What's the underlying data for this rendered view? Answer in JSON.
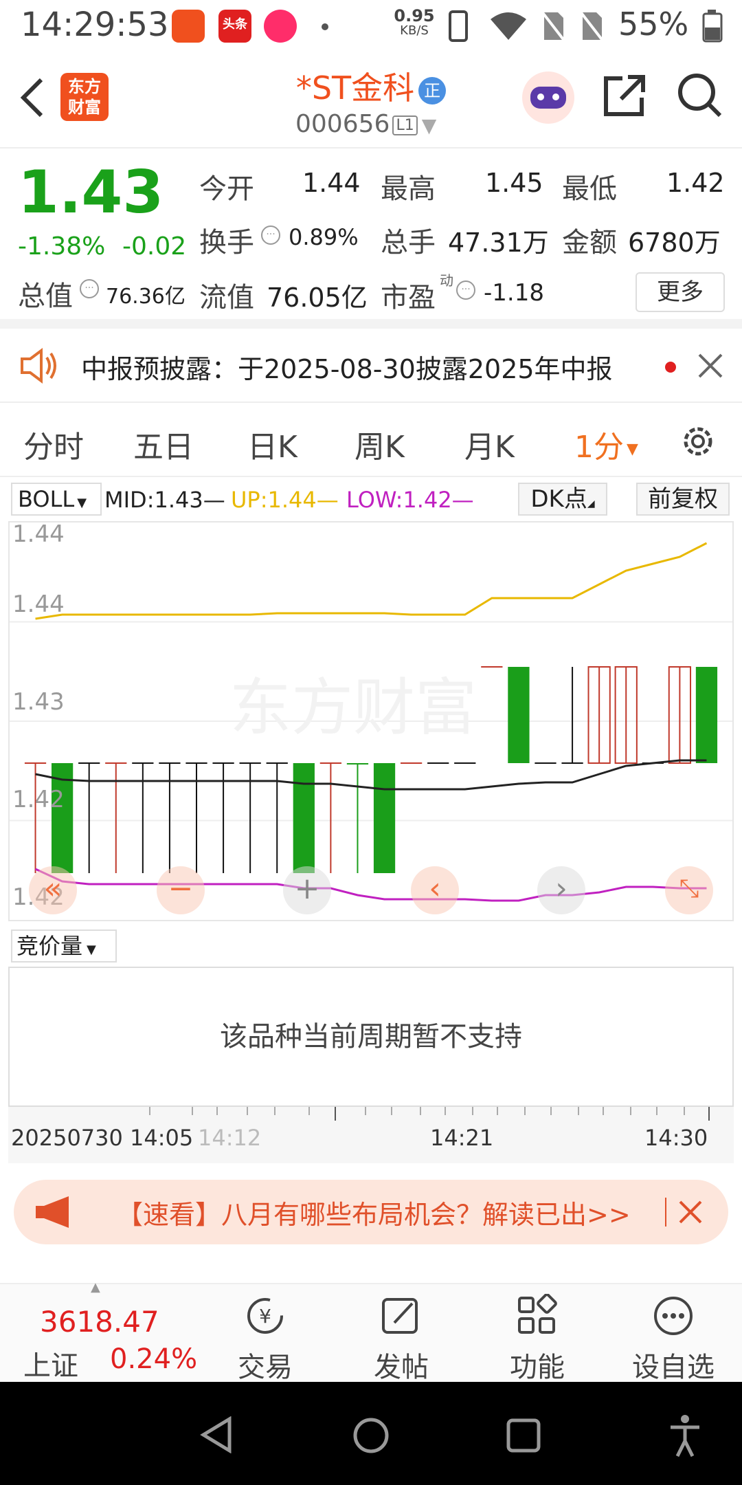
{
  "status_bar": {
    "time": "14:29:53",
    "net_speed": "0.95",
    "net_unit": "KB/S",
    "battery": "55%",
    "app_icons": [
      "toutiao-style-app-icon",
      "toutiao-icon",
      "music-icon"
    ],
    "toutiao_label": "头条"
  },
  "header": {
    "back_icon": "chevron-left-icon",
    "logo_text": "东方财富",
    "title": "*ST金科",
    "badge": "正",
    "code": "000656",
    "level": "L1"
  },
  "quote": {
    "price": "1.43",
    "change_pct": "-1.38%",
    "change": "-0.02",
    "open_label": "今开",
    "open": "1.44",
    "high_label": "最高",
    "high": "1.45",
    "low_label": "最低",
    "low": "1.42",
    "turnover_label": "换手",
    "turnover": "0.89%",
    "volume_label": "总手",
    "volume": "47.31万",
    "amount_label": "金额",
    "amount": "6780万",
    "mktcap_label": "总值",
    "mktcap": "76.36亿",
    "float_label": "流值",
    "float": "76.05亿",
    "pe_label": "市盈",
    "pe_sup": "动",
    "pe": "-1.18",
    "more_label": "更多"
  },
  "notice": {
    "text": "中报预披露：于2025-08-30披露2025年中报"
  },
  "tabs": [
    "分时",
    "五日",
    "日K",
    "周K",
    "月K",
    "1分"
  ],
  "indicator": {
    "name": "BOLL",
    "mid": "MID:1.43—",
    "up": "UP:1.44—",
    "low": "LOW:1.42—",
    "dk_label": "DK点",
    "adjust_label": "前复权"
  },
  "chart_data": {
    "type": "candlestick",
    "y_tick_labels": [
      "1.44",
      "1.44",
      "1.43",
      "1.42",
      "1.42"
    ],
    "x_tick_labels": [
      "20250730 14:05",
      "14:12",
      "14:21",
      "14:30"
    ],
    "watermark": "东方财富",
    "candles": [
      {
        "o": 1.43,
        "c": 1.43,
        "h": 1.43,
        "l": 1.422,
        "color": "red"
      },
      {
        "o": 1.43,
        "c": 1.422,
        "h": 1.43,
        "l": 1.422,
        "color": "green"
      },
      {
        "o": 1.43,
        "c": 1.43,
        "h": 1.43,
        "l": 1.422,
        "color": "black"
      },
      {
        "o": 1.43,
        "c": 1.43,
        "h": 1.43,
        "l": 1.422,
        "color": "red"
      },
      {
        "o": 1.43,
        "c": 1.43,
        "h": 1.43,
        "l": 1.422,
        "color": "black"
      },
      {
        "o": 1.43,
        "c": 1.43,
        "h": 1.43,
        "l": 1.422,
        "color": "black"
      },
      {
        "o": 1.43,
        "c": 1.43,
        "h": 1.43,
        "l": 1.422,
        "color": "black"
      },
      {
        "o": 1.43,
        "c": 1.43,
        "h": 1.43,
        "l": 1.422,
        "color": "black"
      },
      {
        "o": 1.43,
        "c": 1.43,
        "h": 1.43,
        "l": 1.422,
        "color": "black"
      },
      {
        "o": 1.43,
        "c": 1.43,
        "h": 1.43,
        "l": 1.422,
        "color": "black"
      },
      {
        "o": 1.43,
        "c": 1.422,
        "h": 1.43,
        "l": 1.422,
        "color": "green"
      },
      {
        "o": 1.43,
        "c": 1.43,
        "h": 1.43,
        "l": 1.422,
        "color": "red"
      },
      {
        "o": 1.43,
        "c": 1.43,
        "h": 1.43,
        "l": 1.422,
        "color": "green"
      },
      {
        "o": 1.43,
        "c": 1.422,
        "h": 1.43,
        "l": 1.422,
        "color": "green"
      },
      {
        "o": 1.43,
        "c": 1.43,
        "h": 1.43,
        "l": 1.43,
        "color": "red"
      },
      {
        "o": 1.43,
        "c": 1.43,
        "h": 1.43,
        "l": 1.43,
        "color": "black"
      },
      {
        "o": 1.43,
        "c": 1.43,
        "h": 1.43,
        "l": 1.43,
        "color": "black"
      },
      {
        "o": 1.437,
        "c": 1.437,
        "h": 1.437,
        "l": 1.437,
        "color": "red"
      },
      {
        "o": 1.437,
        "c": 1.43,
        "h": 1.437,
        "l": 1.43,
        "color": "green"
      },
      {
        "o": 1.43,
        "c": 1.43,
        "h": 1.43,
        "l": 1.43,
        "color": "black"
      },
      {
        "o": 1.43,
        "c": 1.43,
        "h": 1.437,
        "l": 1.43,
        "color": "black"
      },
      {
        "o": 1.43,
        "c": 1.437,
        "h": 1.437,
        "l": 1.43,
        "color": "red"
      },
      {
        "o": 1.43,
        "c": 1.437,
        "h": 1.437,
        "l": 1.43,
        "color": "red"
      },
      {
        "o": 1.43,
        "c": 1.43,
        "h": 1.43,
        "l": 1.43,
        "color": "black"
      },
      {
        "o": 1.43,
        "c": 1.437,
        "h": 1.437,
        "l": 1.43,
        "color": "red"
      },
      {
        "o": 1.437,
        "c": 1.43,
        "h": 1.437,
        "l": 1.43,
        "color": "green"
      }
    ],
    "boll_up": [
      1.4405,
      1.4408,
      1.4408,
      1.4408,
      1.4408,
      1.4408,
      1.4408,
      1.4408,
      1.4408,
      1.4409,
      1.4409,
      1.4409,
      1.4409,
      1.4409,
      1.4408,
      1.4408,
      1.4408,
      1.442,
      1.442,
      1.442,
      1.442,
      1.443,
      1.444,
      1.4445,
      1.445,
      1.446
    ],
    "boll_mid": [
      1.4292,
      1.4288,
      1.4287,
      1.4287,
      1.4287,
      1.4287,
      1.4287,
      1.4287,
      1.4287,
      1.4287,
      1.4285,
      1.4285,
      1.4283,
      1.4281,
      1.4281,
      1.4281,
      1.4281,
      1.4283,
      1.4285,
      1.4286,
      1.4286,
      1.4292,
      1.4298,
      1.43,
      1.4302,
      1.4302
    ],
    "boll_low": [
      1.4223,
      1.4214,
      1.4212,
      1.4212,
      1.4212,
      1.4212,
      1.4212,
      1.4212,
      1.4212,
      1.4212,
      1.4209,
      1.4209,
      1.4204,
      1.4201,
      1.4201,
      1.4201,
      1.4201,
      1.42,
      1.42,
      1.4204,
      1.4204,
      1.4206,
      1.421,
      1.421,
      1.4209,
      1.4209
    ],
    "colors": {
      "up": "#c0392b",
      "down": "#1a9e1a",
      "flat": "#111111",
      "boll_up": "#e8b800",
      "boll_mid": "#222222",
      "boll_low": "#c020c0"
    }
  },
  "chart_controls": [
    "double-chevron-left-icon",
    "minus-icon",
    "plus-icon",
    "chevron-left-icon",
    "chevron-right-icon",
    "expand-icon"
  ],
  "volume": {
    "selector": "竞价量",
    "message": "该品种当前周期暂不支持"
  },
  "banner": {
    "text": "【速看】八月有哪些布局机会？解读已出>>",
    "icon": "megaphone-icon",
    "close_icon": "close-icon"
  },
  "bottom_nav": {
    "index_value": "3618.47",
    "index_name": "上证",
    "index_change": "0.24%",
    "items": [
      "交易",
      "发帖",
      "功能",
      "设自选"
    ]
  },
  "system_nav": [
    "back-triangle-icon",
    "home-circle-icon",
    "recents-square-icon",
    "accessibility-icon"
  ]
}
